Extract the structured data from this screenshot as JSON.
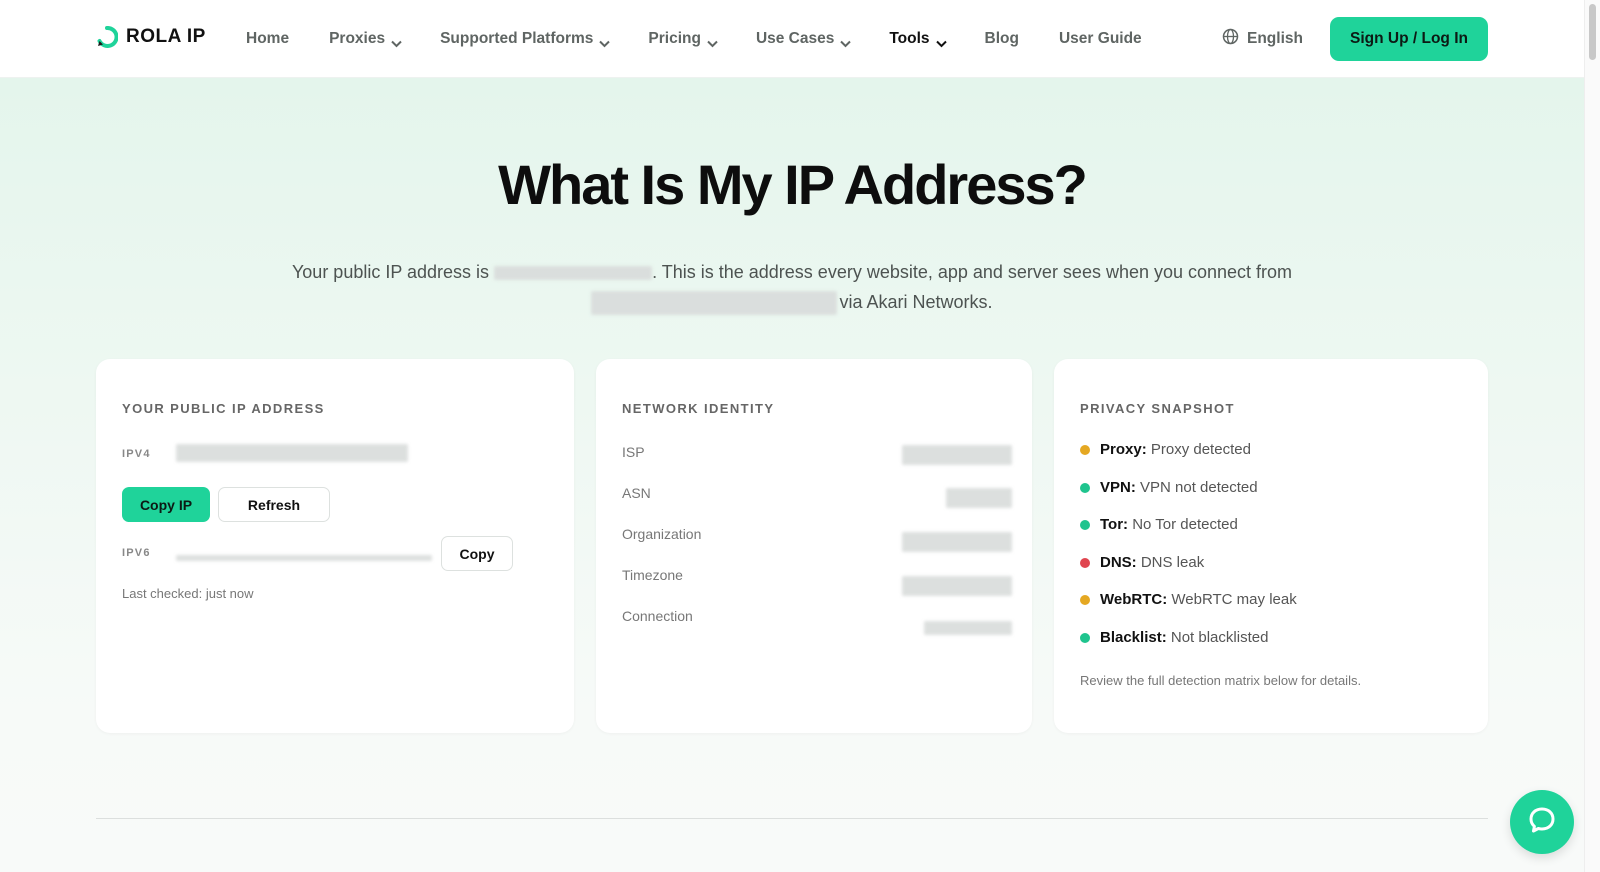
{
  "brand": {
    "name": "ROLA IP",
    "accent": "#1fd39a"
  },
  "nav": {
    "items": [
      {
        "label": "Home",
        "has_dropdown": false
      },
      {
        "label": "Proxies",
        "has_dropdown": true
      },
      {
        "label": "Supported Platforms",
        "has_dropdown": true
      },
      {
        "label": "Pricing",
        "has_dropdown": true
      },
      {
        "label": "Use Cases",
        "has_dropdown": true
      },
      {
        "label": "Tools",
        "has_dropdown": true,
        "active": true
      },
      {
        "label": "Blog",
        "has_dropdown": false
      },
      {
        "label": "User Guide",
        "has_dropdown": false
      }
    ],
    "language": "English",
    "signup_label": "Sign Up / Log In"
  },
  "hero": {
    "title": "What Is My IP Address?",
    "subtitle_part1": "Your public IP address is ",
    "subtitle_part2": ". This is the address every website, app and server sees when you connect from",
    "subtitle_part3": "via Akari Networks."
  },
  "ip_card": {
    "heading": "YOUR PUBLIC IP ADDRESS",
    "ipv4_label": "IPV4",
    "copy_ip_label": "Copy IP",
    "refresh_label": "Refresh",
    "ipv6_label": "IPV6",
    "copy_label": "Copy",
    "last_checked": "Last checked: just now"
  },
  "network_card": {
    "heading": "NETWORK IDENTITY",
    "rows": [
      "ISP",
      "ASN",
      "Organization",
      "Timezone",
      "Connection"
    ]
  },
  "privacy_card": {
    "heading": "PRIVACY SNAPSHOT",
    "items": [
      {
        "key": "Proxy:",
        "value": "Proxy detected",
        "color": "#e5a823"
      },
      {
        "key": "VPN:",
        "value": "VPN not detected",
        "color": "#1fc48e"
      },
      {
        "key": "Tor:",
        "value": "No Tor detected",
        "color": "#1fc48e"
      },
      {
        "key": "DNS:",
        "value": "DNS leak",
        "color": "#e0454f"
      },
      {
        "key": "WebRTC:",
        "value": "WebRTC may leak",
        "color": "#e5a823"
      },
      {
        "key": "Blacklist:",
        "value": "Not blacklisted",
        "color": "#1fc48e"
      }
    ],
    "footnote": "Review the full detection matrix below for details."
  },
  "icons": {
    "logo": "rola-logo-icon",
    "language": "globe-icon",
    "dropdown": "chevron-down-icon",
    "chat": "chat-bubble-icon"
  }
}
